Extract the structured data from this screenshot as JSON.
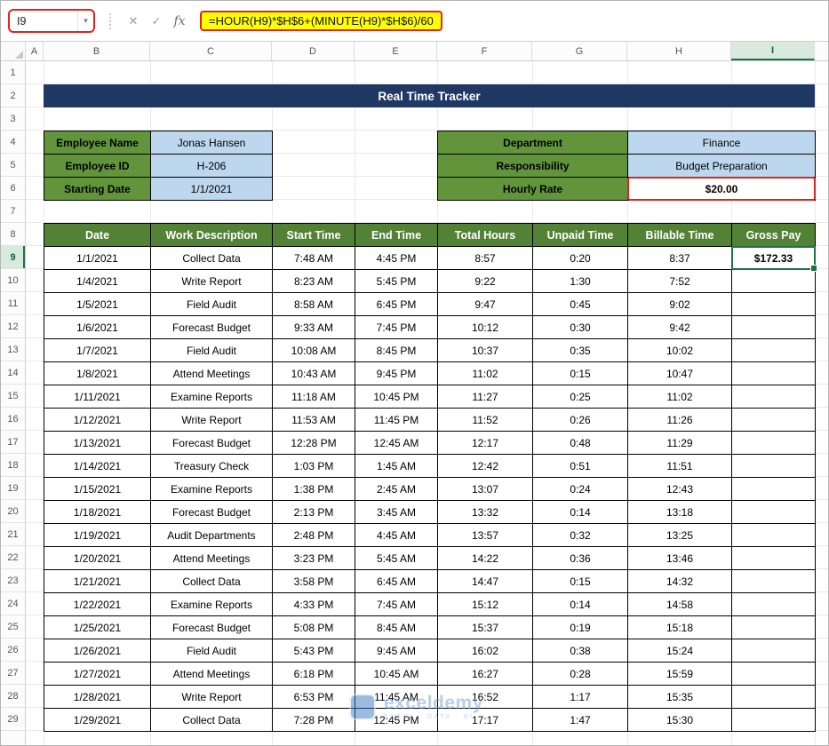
{
  "formula_bar": {
    "name_box": "I9",
    "formula": "=HOUR(H9)*$H$6+(MINUTE(H9)*$H$6)/60"
  },
  "icons": {
    "cancel": "✕",
    "enter": "✓",
    "fx": "fx",
    "dropdown": "▾"
  },
  "grid": {
    "columns": [
      "A",
      "B",
      "C",
      "D",
      "E",
      "F",
      "G",
      "H",
      "I"
    ],
    "row_count": 29,
    "selected_row": 9,
    "selected_column": "I"
  },
  "title": "Real Time Tracker",
  "employee_info": {
    "rows": [
      {
        "label": "Employee Name",
        "value": "Jonas Hansen"
      },
      {
        "label": "Employee ID",
        "value": "H-206"
      },
      {
        "label": "Starting Date",
        "value": "1/1/2021"
      }
    ]
  },
  "job_info": {
    "rows": [
      {
        "label": "Department",
        "value": "Finance"
      },
      {
        "label": "Responsibility",
        "value": "Budget Preparation"
      },
      {
        "label": "Hourly Rate",
        "value": "$20.00"
      }
    ]
  },
  "table": {
    "headers": [
      "Date",
      "Work Description",
      "Start Time",
      "End Time",
      "Total Hours",
      "Unpaid Time",
      "Billable Time",
      "Gross Pay"
    ],
    "active_cell": {
      "row_index": 0,
      "col_index": 7,
      "ref": "I9"
    },
    "rows": [
      [
        "1/1/2021",
        "Collect Data",
        "7:48 AM",
        "4:45 PM",
        "8:57",
        "0:20",
        "8:37",
        "$172.33"
      ],
      [
        "1/4/2021",
        "Write Report",
        "8:23 AM",
        "5:45 PM",
        "9:22",
        "1:30",
        "7:52",
        ""
      ],
      [
        "1/5/2021",
        "Field Audit",
        "8:58 AM",
        "6:45 PM",
        "9:47",
        "0:45",
        "9:02",
        ""
      ],
      [
        "1/6/2021",
        "Forecast Budget",
        "9:33 AM",
        "7:45 PM",
        "10:12",
        "0:30",
        "9:42",
        ""
      ],
      [
        "1/7/2021",
        "Field Audit",
        "10:08 AM",
        "8:45 PM",
        "10:37",
        "0:35",
        "10:02",
        ""
      ],
      [
        "1/8/2021",
        "Attend Meetings",
        "10:43 AM",
        "9:45 PM",
        "11:02",
        "0:15",
        "10:47",
        ""
      ],
      [
        "1/11/2021",
        "Examine Reports",
        "11:18 AM",
        "10:45 PM",
        "11:27",
        "0:25",
        "11:02",
        ""
      ],
      [
        "1/12/2021",
        "Write Report",
        "11:53 AM",
        "11:45 PM",
        "11:52",
        "0:26",
        "11:26",
        ""
      ],
      [
        "1/13/2021",
        "Forecast Budget",
        "12:28 PM",
        "12:45 AM",
        "12:17",
        "0:48",
        "11:29",
        ""
      ],
      [
        "1/14/2021",
        "Treasury Check",
        "1:03 PM",
        "1:45 AM",
        "12:42",
        "0:51",
        "11:51",
        ""
      ],
      [
        "1/15/2021",
        "Examine Reports",
        "1:38 PM",
        "2:45 AM",
        "13:07",
        "0:24",
        "12:43",
        ""
      ],
      [
        "1/18/2021",
        "Forecast Budget",
        "2:13 PM",
        "3:45 AM",
        "13:32",
        "0:14",
        "13:18",
        ""
      ],
      [
        "1/19/2021",
        "Audit Departments",
        "2:48 PM",
        "4:45 AM",
        "13:57",
        "0:32",
        "13:25",
        ""
      ],
      [
        "1/20/2021",
        "Attend Meetings",
        "3:23 PM",
        "5:45 AM",
        "14:22",
        "0:36",
        "13:46",
        ""
      ],
      [
        "1/21/2021",
        "Collect Data",
        "3:58 PM",
        "6:45 AM",
        "14:47",
        "0:15",
        "14:32",
        ""
      ],
      [
        "1/22/2021",
        "Examine Reports",
        "4:33 PM",
        "7:45 AM",
        "15:12",
        "0:14",
        "14:58",
        ""
      ],
      [
        "1/25/2021",
        "Forecast Budget",
        "5:08 PM",
        "8:45 AM",
        "15:37",
        "0:19",
        "15:18",
        ""
      ],
      [
        "1/26/2021",
        "Field Audit",
        "5:43 PM",
        "9:45 AM",
        "16:02",
        "0:38",
        "15:24",
        ""
      ],
      [
        "1/27/2021",
        "Attend Meetings",
        "6:18 PM",
        "10:45 AM",
        "16:27",
        "0:28",
        "15:59",
        ""
      ],
      [
        "1/28/2021",
        "Write Report",
        "6:53 PM",
        "11:45 AM",
        "16:52",
        "1:17",
        "15:35",
        ""
      ],
      [
        "1/29/2021",
        "Collect Data",
        "7:28 PM",
        "12:45 PM",
        "17:17",
        "1:47",
        "15:30",
        ""
      ]
    ]
  },
  "watermark": {
    "name": "exceldemy",
    "tagline": "EXCEL · DATA · BI"
  },
  "colors": {
    "title_bg": "#1f3864",
    "header_green": "#538135",
    "label_green": "#61943b",
    "light_blue": "#bdd7ee",
    "selection_green": "#1e7145",
    "annotation_red": "#e0241b",
    "highlight_yellow": "#ffff00"
  }
}
